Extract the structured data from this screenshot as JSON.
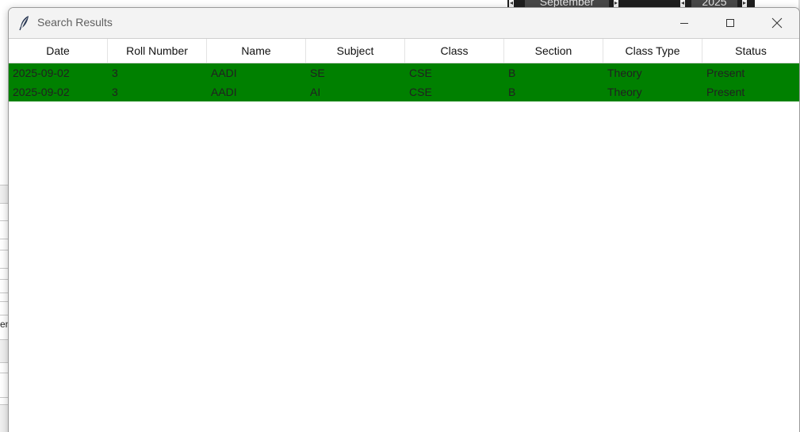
{
  "background": {
    "calendar": {
      "month": "September",
      "year": "2025"
    },
    "partial_text": "en"
  },
  "window": {
    "title": "Search Results",
    "icon": "feather-icon",
    "controls": {
      "minimize": "minimize-icon",
      "maximize": "maximize-icon",
      "close": "close-icon"
    }
  },
  "table": {
    "columns": [
      "Date",
      "Roll Number",
      "Name",
      "Subject",
      "Class",
      "Section",
      "Class Type",
      "Status"
    ],
    "rows": [
      [
        "2025-09-02",
        "3",
        "AADI",
        "SE",
        "CSE",
        "B",
        "Theory",
        "Present"
      ],
      [
        "2025-09-02",
        "3",
        "AADI",
        "AI",
        "CSE",
        "B",
        "Theory",
        "Present"
      ]
    ],
    "row_color": "#008000"
  }
}
